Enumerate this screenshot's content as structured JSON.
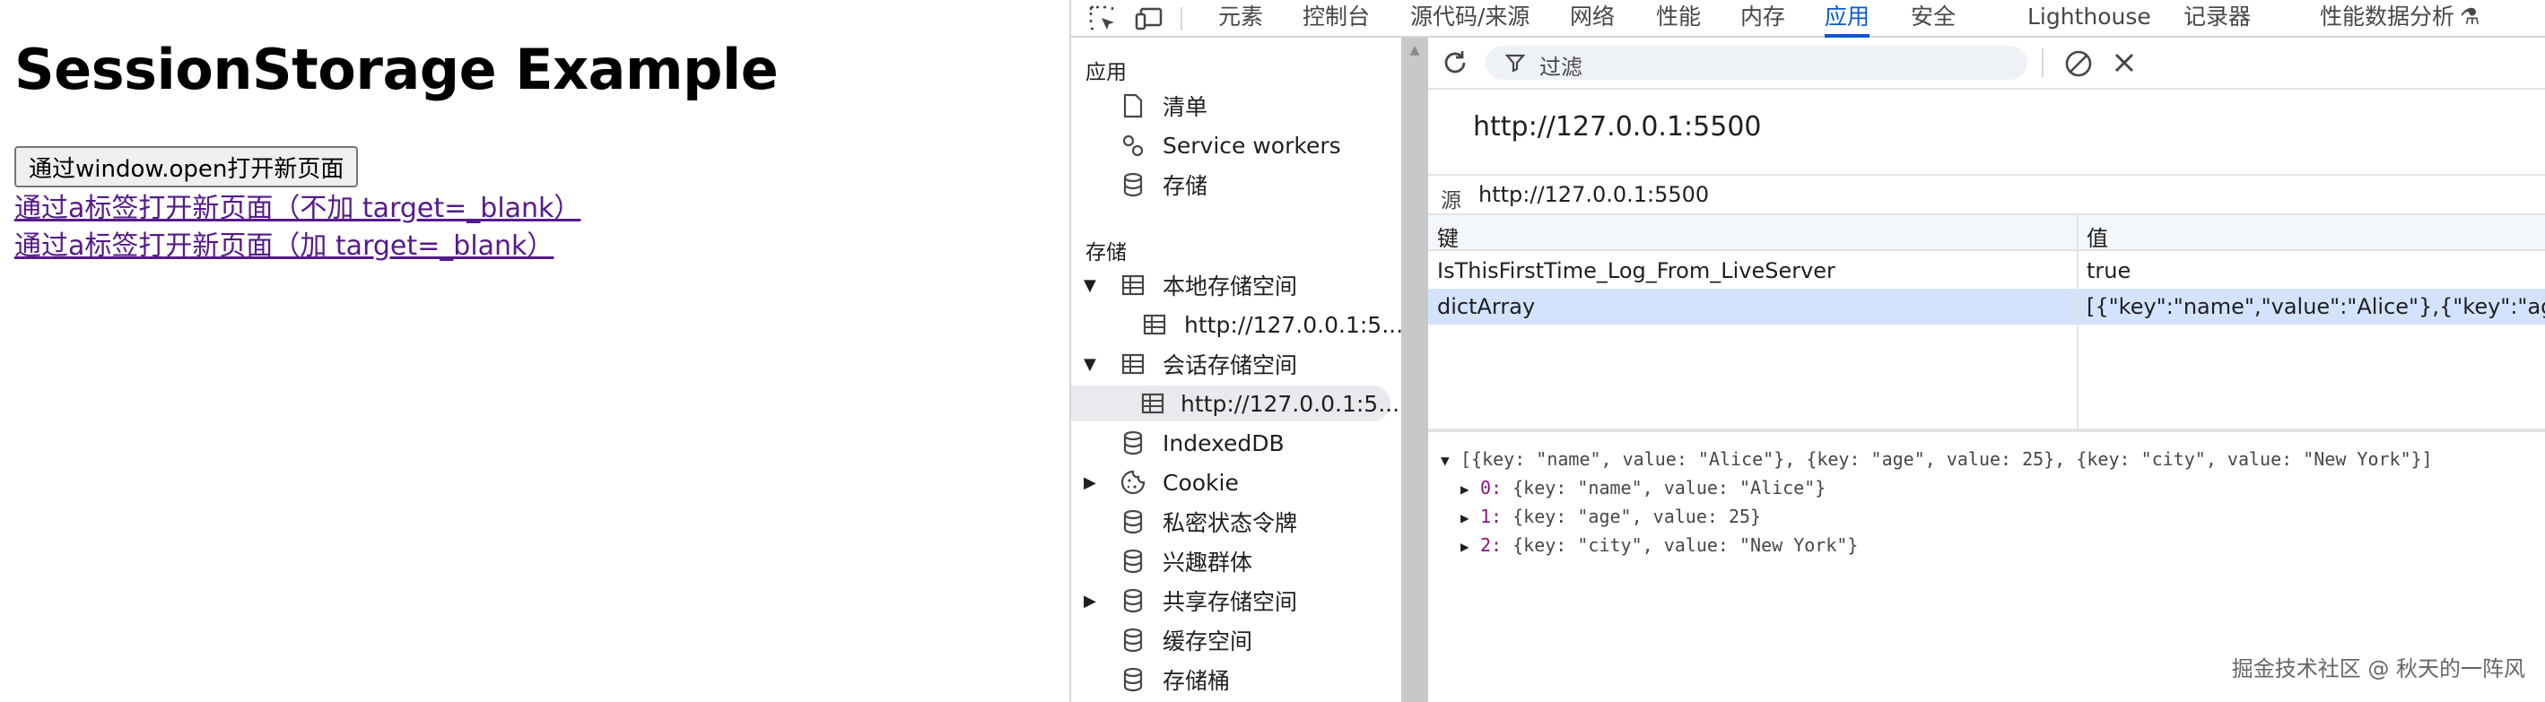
{
  "webpage": {
    "title": "SessionStorage Example",
    "button_label": "通过window.open打开新页面",
    "link1": "通过a标签打开新页面（不加 target=_blank）",
    "link2": "通过a标签打开新页面（加 target=_blank）"
  },
  "devtools": {
    "tabs": [
      "元素",
      "控制台",
      "源代码/来源",
      "网络",
      "性能",
      "内存",
      "应用",
      "安全",
      "Lighthouse",
      "记录器",
      "性能数据分析"
    ],
    "active_tab": "应用",
    "sidebar": {
      "app_header": "应用",
      "app_items": [
        "清单",
        "Service workers",
        "存储"
      ],
      "storage_header": "存储",
      "local_storage": "本地存储空间",
      "local_storage_child": "http://127.0.0.1:5...",
      "session_storage": "会话存储空间",
      "session_storage_child": "http://127.0.0.1:5...",
      "indexeddb": "IndexedDB",
      "cookie": "Cookie",
      "private_token": "私密状态令牌",
      "interest_groups": "兴趣群体",
      "shared_storage": "共享存储空间",
      "cache_storage": "缓存空间",
      "storage_buckets": "存储桶"
    },
    "toolbar": {
      "filter_placeholder": "过滤"
    },
    "origin_title": "http://127.0.0.1:5500",
    "origin_label": "源",
    "origin_value": "http://127.0.0.1:5500",
    "table": {
      "col_key": "键",
      "col_value": "值",
      "rows": [
        {
          "key": "IsThisFirstTime_Log_From_LiveServer",
          "value": "true"
        },
        {
          "key": "dictArray",
          "value": "[{\"key\":\"name\",\"value\":\"Alice\"},{\"key\":\"age\",\"value\":25},{\"key\":\"city\",\"value\":\"New York\"}]"
        }
      ]
    },
    "preview": {
      "root": "[{key: \"name\", value: \"Alice\"}, {key: \"age\", value: 25}, {key: \"city\", value: \"New York\"}]",
      "items": [
        {
          "index": "0",
          "value": "{key: \"name\", value: \"Alice\"}"
        },
        {
          "index": "1",
          "value": "{key: \"age\", value: 25}"
        },
        {
          "index": "2",
          "value": "{key: \"city\", value: \"New York\"}"
        }
      ]
    }
  },
  "watermark": "掘金技术社区 @ 秋天的一阵风"
}
